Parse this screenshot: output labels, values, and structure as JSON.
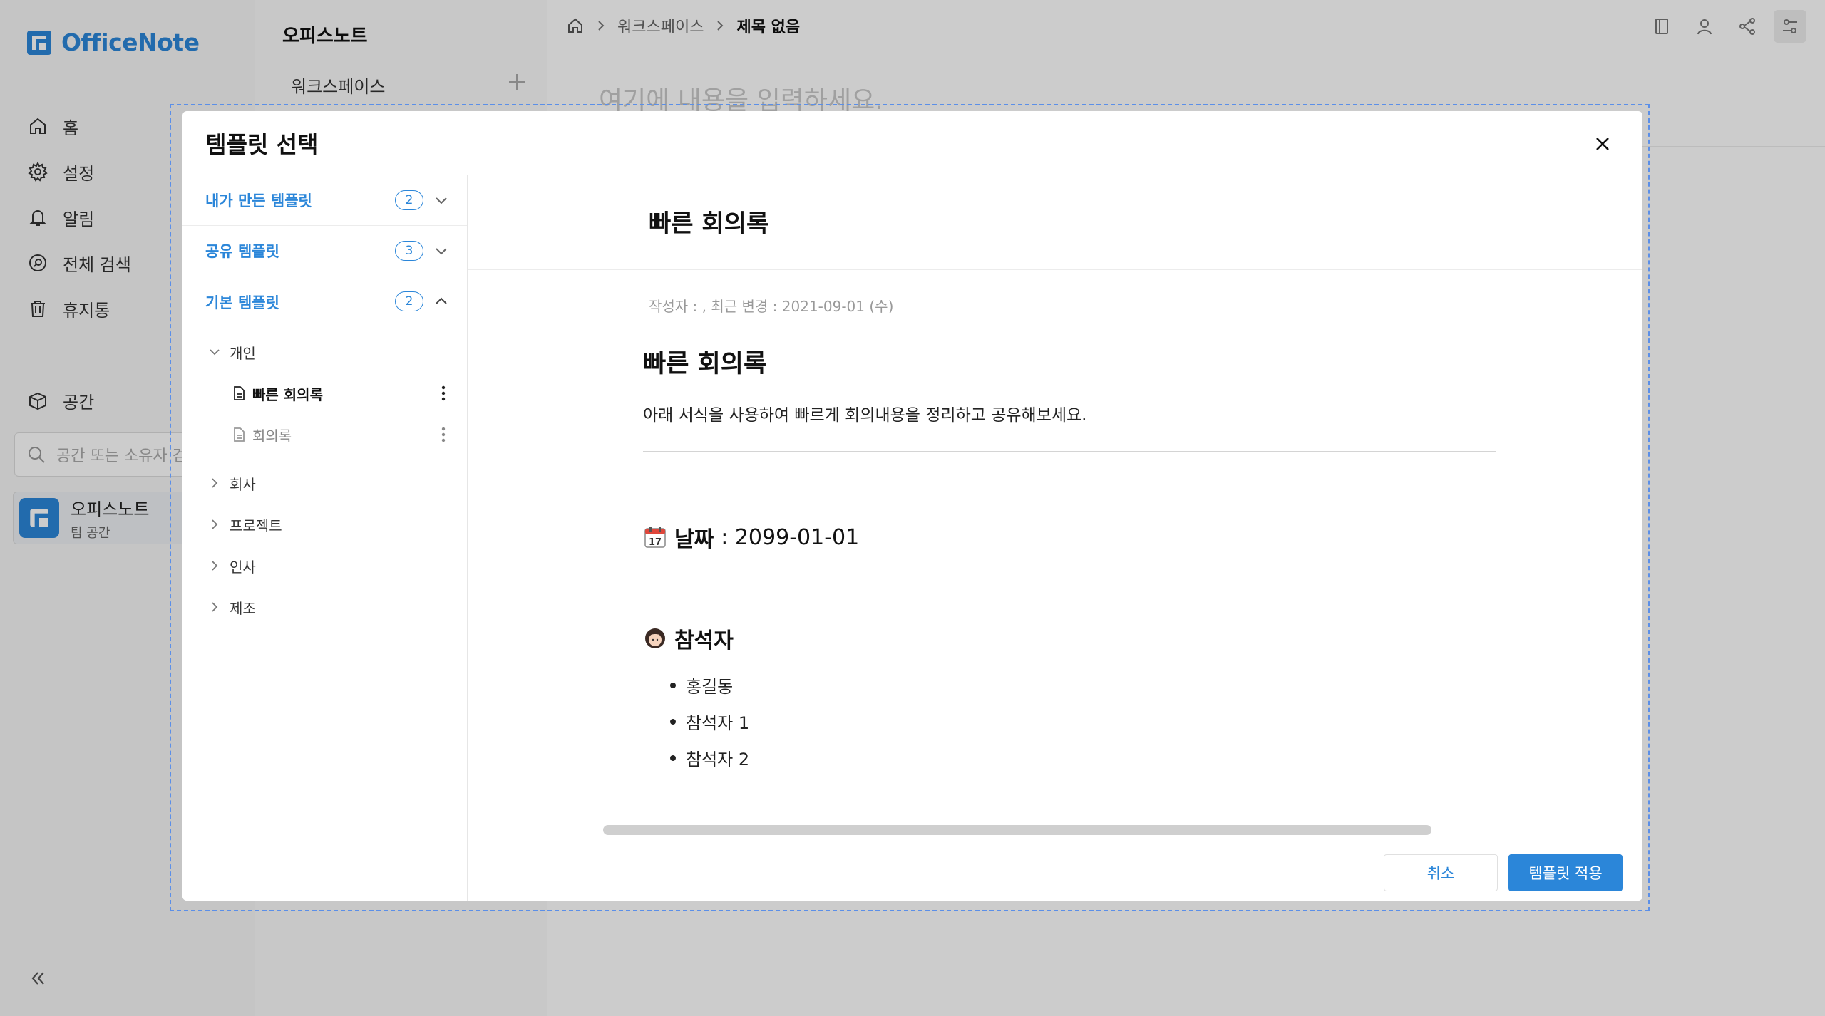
{
  "app": {
    "logo_text": "OfficeNote",
    "accent": "#2b86d9"
  },
  "nav": {
    "items": [
      {
        "label": "홈",
        "icon": "home-icon"
      },
      {
        "label": "설정",
        "icon": "gear-icon"
      },
      {
        "label": "알림",
        "icon": "bell-icon"
      },
      {
        "label": "전체 검색",
        "icon": "search-icon"
      },
      {
        "label": "휴지통",
        "icon": "trash-icon"
      }
    ],
    "space_label": "공간",
    "space_search_placeholder": "공간 또는 소유자 검색",
    "space_card": {
      "name": "오피스노트",
      "sub": "팀 공간"
    }
  },
  "page_tree": {
    "title": "오피스노트",
    "workspace": "워크스페이스"
  },
  "doc": {
    "breadcrumb": {
      "parent": "워크스페이스",
      "current": "제목 없음"
    },
    "placeholder": "여기에 내용을 입력하세요."
  },
  "modal": {
    "title": "템플릿 선택",
    "categories": [
      {
        "label": "내가 만든 템플릿",
        "count": "2",
        "expanded": false
      },
      {
        "label": "공유 템플릿",
        "count": "3",
        "expanded": false
      },
      {
        "label": "기본 템플릿",
        "count": "2",
        "expanded": true
      }
    ],
    "tree": {
      "folder_open": "개인",
      "templates": [
        "빠른 회의록",
        "회의록"
      ],
      "folders": [
        "회사",
        "프로젝트",
        "인사",
        "제조"
      ]
    },
    "preview": {
      "title": "빠른 회의록",
      "meta": "작성자 : ,  최근 변경 : 2021-09-01 (수)",
      "heading": "빠른 회의록",
      "description": "아래 서식을 사용하여 빠르게 회의내용을 정리하고 공유해보세요.",
      "date_label": "날짜",
      "date_value": " : 2099-01-01",
      "attendees_label": "참석자",
      "attendees": [
        "홍길동",
        "참석자 1",
        "참석자 2"
      ]
    },
    "cancel_label": "취소",
    "apply_label": "템플릿 적용"
  }
}
